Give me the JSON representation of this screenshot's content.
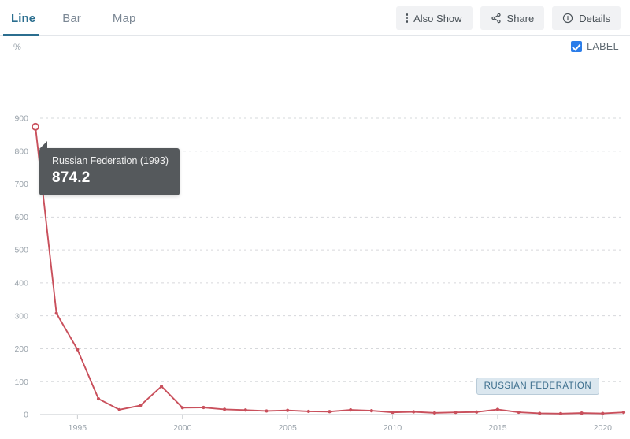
{
  "toolbar": {
    "tabs": [
      {
        "label": "Line",
        "active": true
      },
      {
        "label": "Bar",
        "active": false
      },
      {
        "label": "Map",
        "active": false
      }
    ],
    "actions": [
      {
        "label": "Also Show",
        "icon": "vertical-dots-icon"
      },
      {
        "label": "Share",
        "icon": "share-icon"
      },
      {
        "label": "Details",
        "icon": "info-circle-icon"
      }
    ]
  },
  "chart_header": {
    "unit": "%",
    "label_checkbox": {
      "text": "LABEL",
      "checked": true,
      "color": "#2b7de9"
    }
  },
  "tooltip": {
    "title": "Russian Federation (1993)",
    "value": "874.2"
  },
  "legend_chip": "RUSSIAN FEDERATION",
  "chart_data": {
    "type": "line",
    "title": "",
    "xlabel": "",
    "ylabel": "%",
    "xlim": [
      1993,
      2021
    ],
    "ylim": [
      0,
      900
    ],
    "ytick_values": [
      0,
      100,
      200,
      300,
      400,
      500,
      600,
      700,
      800,
      900
    ],
    "ytick_labels": [
      "0",
      "100",
      "200",
      "300",
      "400",
      "500",
      "600",
      "700",
      "800",
      "900"
    ],
    "xtick_values": [
      1995,
      2000,
      2005,
      2010,
      2015,
      2020
    ],
    "xtick_labels": [
      "1995",
      "2000",
      "2005",
      "2010",
      "2015",
      "2020"
    ],
    "grid": true,
    "legend_position": "inline-right",
    "line_color": "#c9505c",
    "highlight_point": {
      "x": 1993,
      "y": 874.2
    },
    "series": [
      {
        "name": "Russian Federation",
        "x": [
          1993,
          1994,
          1995,
          1996,
          1997,
          1998,
          1999,
          2000,
          2001,
          2002,
          2003,
          2004,
          2005,
          2006,
          2007,
          2008,
          2009,
          2010,
          2011,
          2012,
          2013,
          2014,
          2015,
          2016,
          2017,
          2018,
          2019,
          2020,
          2021
        ],
        "values": [
          874.2,
          307.6,
          197.4,
          47.7,
          14.8,
          27.7,
          85.7,
          20.8,
          21.5,
          15.8,
          13.7,
          10.9,
          12.7,
          9.7,
          9.0,
          14.1,
          11.7,
          6.9,
          8.4,
          5.1,
          6.8,
          7.8,
          15.5,
          7.0,
          3.7,
          2.9,
          4.5,
          3.4,
          6.7
        ],
        "color": "#c9505c"
      }
    ]
  }
}
